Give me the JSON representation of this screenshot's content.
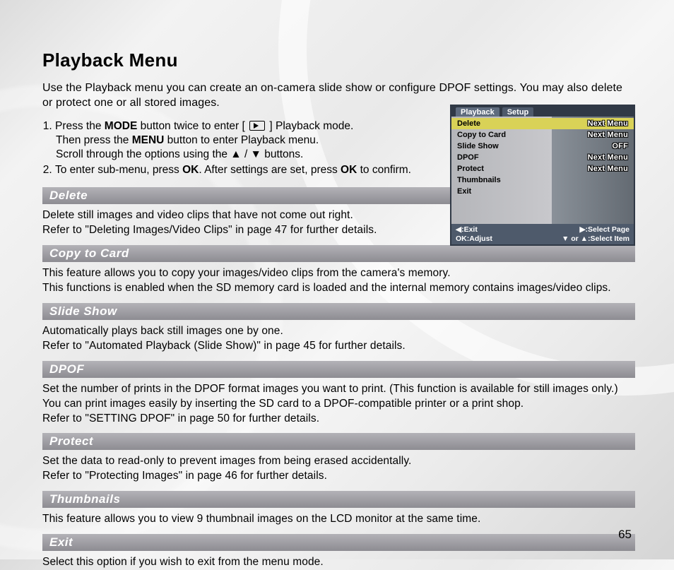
{
  "title": "Playback Menu",
  "intro": "Use the Playback menu you can create an on-camera slide show or configure DPOF settings. You may also delete or protect one or all stored images.",
  "steps": {
    "s1a_pre": "Press the ",
    "s1a_mode": "MODE",
    "s1a_post": " button twice to enter  [ ",
    "s1a_tail": " ] Playback mode.",
    "s1b_pre": "Then press the ",
    "s1b_menu": "MENU",
    "s1b_post": " button to enter Playback menu.",
    "s1c": "Scroll through the options using the ▲ / ▼ buttons.",
    "s2_pre": "To enter sub-menu, press ",
    "s2_ok1": "OK",
    "s2_mid": ". After settings are set, press ",
    "s2_ok2": "OK",
    "s2_post": " to confirm."
  },
  "sections": [
    {
      "title": "Delete",
      "body": "Delete still images and video clips that have not come out right.\nRefer to \"Deleting Images/Video Clips\" in page 47 for further details."
    },
    {
      "title": "Copy to Card",
      "body": "This feature allows you to copy your images/video clips from the camera's memory.\nThis functions is enabled when the SD memory card is loaded and the internal memory contains images/video clips."
    },
    {
      "title": "Slide Show",
      "body": "Automatically plays back still images one by one.\nRefer to \"Automated Playback (Slide Show)\" in page 45 for further details."
    },
    {
      "title": "DPOF",
      "body": "Set the number of prints in the DPOF format images you want to print.  (This function is available for still images only.)\nYou can print images easily by inserting the SD card to a DPOF-compatible printer or a print shop.\nRefer to \"SETTING DPOF\" in page 50 for further details."
    },
    {
      "title": "Protect",
      "body": "Set the data to read-only to prevent images from being erased accidentally.\nRefer to \"Protecting Images\" in page 46 for further details."
    },
    {
      "title": "Thumbnails",
      "body": "This feature allows you to view 9 thumbnail images on the LCD monitor at the same time."
    },
    {
      "title": "Exit",
      "body": "Select this option if you wish to exit from the menu mode."
    }
  ],
  "lcd": {
    "tabs": [
      "Playback",
      "Setup"
    ],
    "items": [
      {
        "label": "Delete",
        "value": "Next Menu",
        "selected": true
      },
      {
        "label": "Copy to Card",
        "value": "Next Menu"
      },
      {
        "label": "Slide Show",
        "value": "OFF"
      },
      {
        "label": "DPOF",
        "value": "Next Menu"
      },
      {
        "label": "Protect",
        "value": "Next Menu"
      },
      {
        "label": "Thumbnails",
        "value": ""
      },
      {
        "label": "Exit",
        "value": ""
      }
    ],
    "footer": {
      "left1": "◀:Exit",
      "left2": "OK:Adjust",
      "right1": "▶:Select Page",
      "right2": "▼ or ▲:Select Item"
    }
  },
  "pageNumber": "65"
}
